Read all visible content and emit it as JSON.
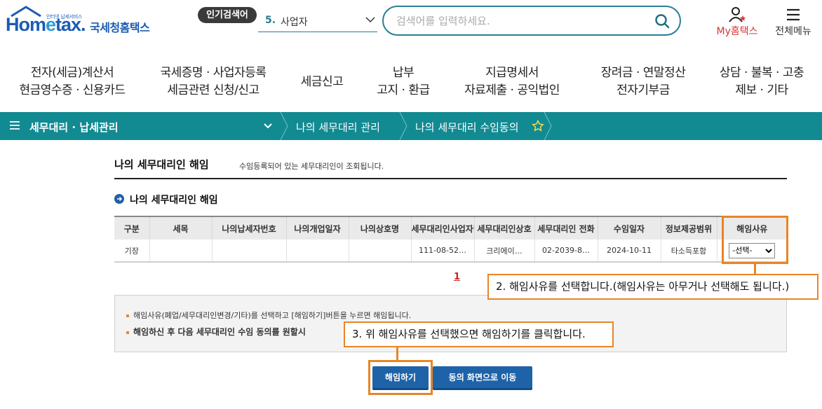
{
  "header": {
    "logo_sub": "인터넷 납세서비스",
    "logo_hometax": "Hometax.",
    "logo_korean": "국세청홈택스",
    "popular_badge": "인기검색어",
    "popular_rank": "5.",
    "popular_term": "사업자",
    "search_placeholder": "검색어를 입력하세요.",
    "my_hometax": "My홈택스",
    "all_menu": "전체메뉴"
  },
  "gnb": [
    {
      "line1": "전자(세금)계산서",
      "line2": "현금영수증 · 신용카드"
    },
    {
      "line1": "국세증명 · 사업자등록",
      "line2": "세금관련 신청/신고"
    },
    {
      "line1": "세금신고",
      "line2": ""
    },
    {
      "line1": "납부",
      "line2": "고지 · 환급"
    },
    {
      "line1": "지급명세서",
      "line2": "자료제출 · 공익법인"
    },
    {
      "line1": "장려금 · 연말정산",
      "line2": "전자기부금"
    },
    {
      "line1": "상담 · 불복 · 고충",
      "line2": "제보 · 기타"
    }
  ],
  "breadcrumb": {
    "menu": "세무대리 · 납세관리",
    "level2": "나의 세무대리 관리",
    "level3": "나의 세무대리 수임동의"
  },
  "page": {
    "title": "나의 세무대리인 해임",
    "description": "수임등록되어 있는 세무대리인이 조회됩니다.",
    "section_title": "나의 세무대리인 해임"
  },
  "table": {
    "headers": [
      "구분",
      "세목",
      "나의납세자번호",
      "나의개업일자",
      "나의상호명",
      "세무대리인사업자번호",
      "세무대리인상호",
      "세무대리인 전화",
      "수임일자",
      "정보제공범위",
      "해임사유"
    ],
    "rows": [
      [
        "기장",
        "",
        "",
        "",
        "",
        "111-08-52…",
        "크리에이…",
        "02-2039-8…",
        "2024-10-11",
        "타소득포함",
        ""
      ]
    ],
    "reason_selected": "-선택-"
  },
  "pagination": {
    "current": "1"
  },
  "notice": {
    "line1": "해임사유(폐업/세무대리인변경/기타)를 선택하고 [해임하기]버튼을 누르면 해임됩니다.",
    "line2": "해임하신 후 다음 세무대리인 수임 동의를 원할시"
  },
  "buttons": {
    "cancel": "해임하기",
    "goto_consent": "동의 화면으로 이동"
  },
  "callouts": {
    "step2": "2. 해임사유를 선택합니다.(해임사유는 아무거나 선택해도 됩니다.)",
    "step3": "3. 위 해임사유를 선택했으면 해임하기를 클릭합니다."
  },
  "colors": {
    "brand_teal": "#128a92",
    "button_blue": "#1e63a8",
    "highlight_orange": "#e98526",
    "logo_blue": "#1b5cb3"
  }
}
